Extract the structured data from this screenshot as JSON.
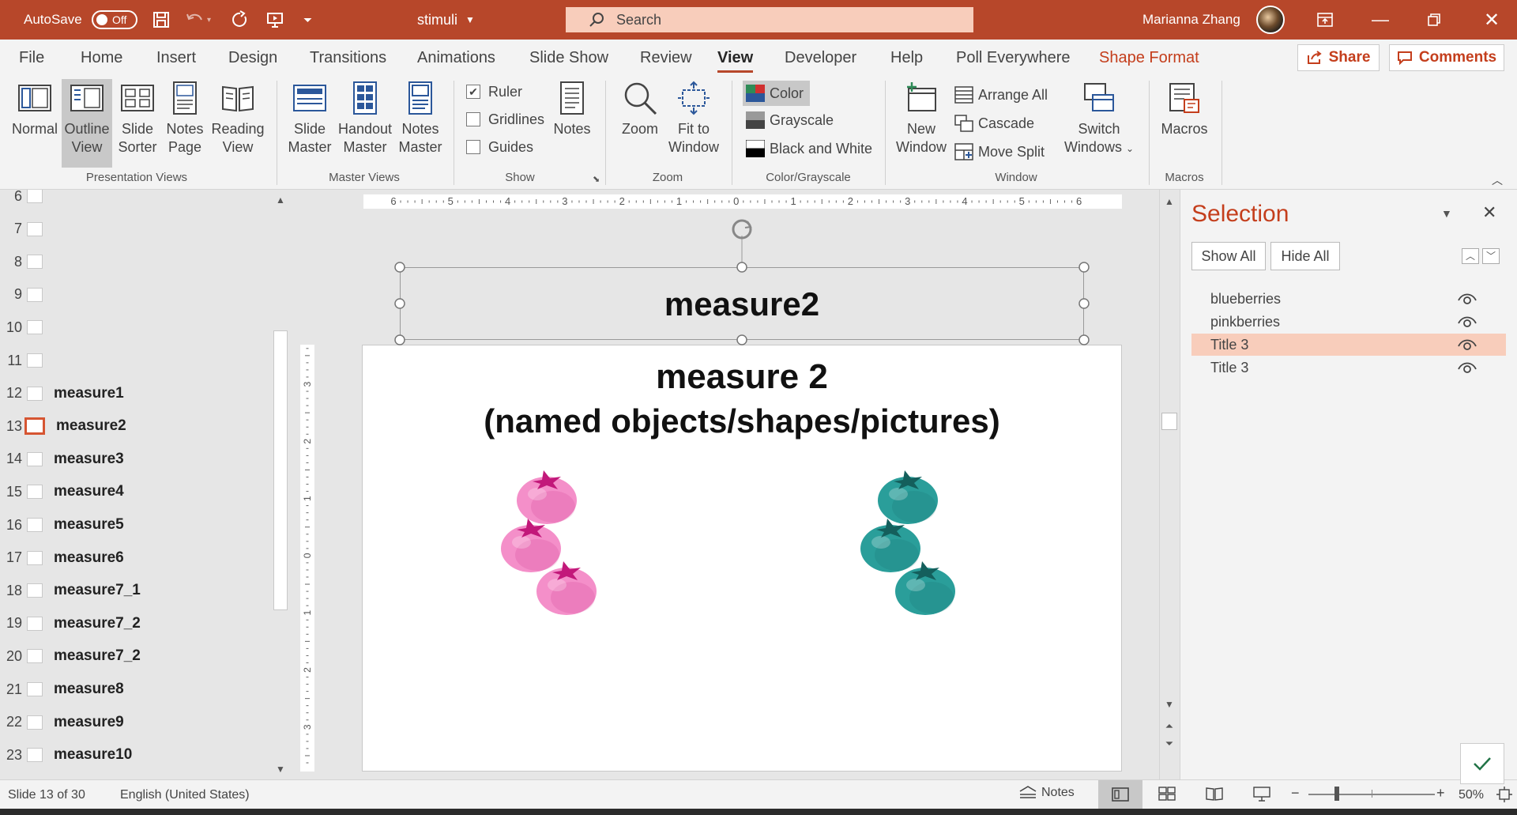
{
  "titlebar": {
    "autosave_label": "AutoSave",
    "autosave_state": "Off",
    "doc_title": "stimuli",
    "search_placeholder": "Search",
    "user_name": "Marianna Zhang"
  },
  "tabs": [
    "File",
    "Home",
    "Insert",
    "Design",
    "Transitions",
    "Animations",
    "Slide Show",
    "Review",
    "View",
    "Developer",
    "Help",
    "Poll Everywhere",
    "Shape Format"
  ],
  "active_tab": "View",
  "share_label": "Share",
  "comments_label": "Comments",
  "ribbon": {
    "presentation_views": {
      "label": "Presentation Views",
      "normal": "Normal",
      "outline_1": "Outline",
      "outline_2": "View",
      "sorter_1": "Slide",
      "sorter_2": "Sorter",
      "notespage_1": "Notes",
      "notespage_2": "Page",
      "reading_1": "Reading",
      "reading_2": "View"
    },
    "master_views": {
      "label": "Master Views",
      "slide_1": "Slide",
      "slide_2": "Master",
      "handout_1": "Handout",
      "handout_2": "Master",
      "notes_1": "Notes",
      "notes_2": "Master"
    },
    "show": {
      "label": "Show",
      "ruler": "Ruler",
      "ruler_checked": true,
      "gridlines": "Gridlines",
      "guides": "Guides",
      "notes": "Notes"
    },
    "zoom": {
      "label": "Zoom",
      "zoom": "Zoom",
      "fit_1": "Fit to",
      "fit_2": "Window"
    },
    "color": {
      "label": "Color/Grayscale",
      "color": "Color",
      "grayscale": "Grayscale",
      "bw": "Black and White"
    },
    "window": {
      "label": "Window",
      "new_1": "New",
      "new_2": "Window",
      "arrange": "Arrange All",
      "cascade": "Cascade",
      "movesplit": "Move Split",
      "switch_1": "Switch",
      "switch_2": "Windows"
    },
    "macros": {
      "label": "Macros",
      "macros": "Macros"
    }
  },
  "slides": [
    {
      "num": "6",
      "title": ""
    },
    {
      "num": "7",
      "title": ""
    },
    {
      "num": "8",
      "title": ""
    },
    {
      "num": "9",
      "title": ""
    },
    {
      "num": "10",
      "title": ""
    },
    {
      "num": "11",
      "title": ""
    },
    {
      "num": "12",
      "title": "measure1"
    },
    {
      "num": "13",
      "title": "measure2"
    },
    {
      "num": "14",
      "title": "measure3"
    },
    {
      "num": "15",
      "title": "measure4"
    },
    {
      "num": "16",
      "title": "measure5"
    },
    {
      "num": "17",
      "title": "measure6"
    },
    {
      "num": "18",
      "title": "measure7_1"
    },
    {
      "num": "19",
      "title": "measure7_2"
    },
    {
      "num": "20",
      "title": "measure7_2"
    },
    {
      "num": "21",
      "title": "measure8"
    },
    {
      "num": "22",
      "title": "measure9"
    },
    {
      "num": "23",
      "title": "measure10"
    }
  ],
  "current_slide": "13",
  "ruler_labels": [
    "6",
    "5",
    "4",
    "3",
    "2",
    "1",
    "0",
    "1",
    "2",
    "3",
    "4",
    "5",
    "6"
  ],
  "vruler_labels": [
    "3",
    "2",
    "1",
    "0",
    "1",
    "2",
    "3"
  ],
  "slide": {
    "selected_title": "measure2",
    "heading_line1": "measure 2",
    "heading_line2": "(named objects/shapes/pictures)"
  },
  "berry_colors": {
    "pink": "#f48fc9",
    "pink_leaf": "#c2187a",
    "teal": "#2a9e9a",
    "teal_leaf": "#145f5c"
  },
  "selection_pane": {
    "title": "Selection",
    "show_all": "Show All",
    "hide_all": "Hide All",
    "items": [
      "blueberries",
      "pinkberries",
      "Title 3",
      "Title 3"
    ],
    "selected_index": 2
  },
  "status": {
    "slide_info": "Slide 13 of 30",
    "language": "English (United States)",
    "notes": "Notes",
    "zoom": "50%"
  },
  "colors": {
    "accent": "#b7472a",
    "selection_highlight": "#f8cdbb"
  }
}
